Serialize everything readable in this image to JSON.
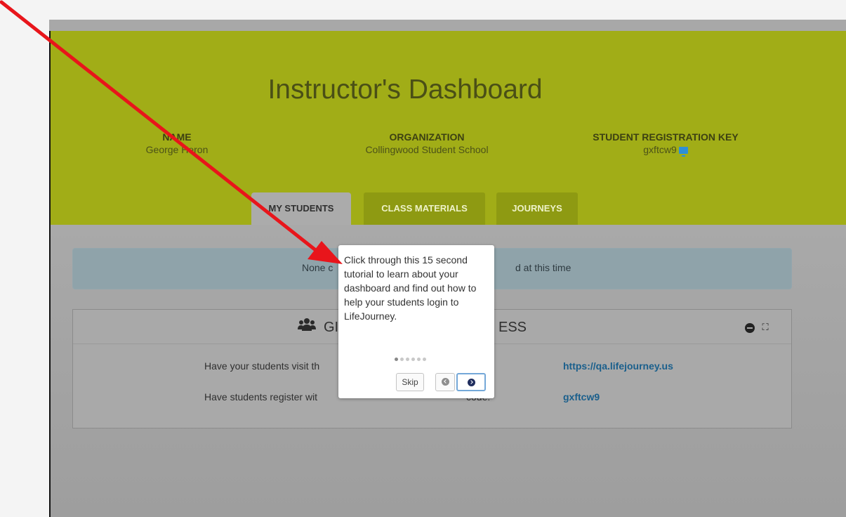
{
  "header": {
    "title": "Instructor's Dashboard"
  },
  "info": {
    "name_label": "NAME",
    "name_value": "George Heron",
    "org_label": "ORGANIZATION",
    "org_value": "Collingwood Student School",
    "key_label": "STUDENT REGISTRATION KEY",
    "key_value": "gxftcw9"
  },
  "tabs": [
    {
      "label": "MY STUDENTS",
      "active": true
    },
    {
      "label": "CLASS MATERIALS",
      "active": false
    },
    {
      "label": "JOURNEYS",
      "active": false
    }
  ],
  "alert": {
    "text_left": "None c",
    "text_right": "d at this time"
  },
  "panel": {
    "title_left": "GI",
    "title_right": "ESS",
    "row1_text": "Have your students visit th",
    "row1_link": "https://qa.lifejourney.us",
    "row2_text_left": "Have students register wit",
    "row2_text_right": "code:",
    "row2_link": "gxftcw9"
  },
  "tutorial": {
    "text": "Click through this 15 second tutorial to learn about your dashboard and find out how to help your students login to LifeJourney.",
    "skip_label": "Skip",
    "total_steps": 6,
    "current_step": 1
  },
  "colors": {
    "hero": "#a1ad17",
    "arrow": "#e8151b",
    "link": "#1a5f8c"
  },
  "icons": [
    "monitor-icon",
    "group-icon",
    "minus-circle-icon",
    "expand-icon",
    "prev-icon",
    "next-icon"
  ]
}
